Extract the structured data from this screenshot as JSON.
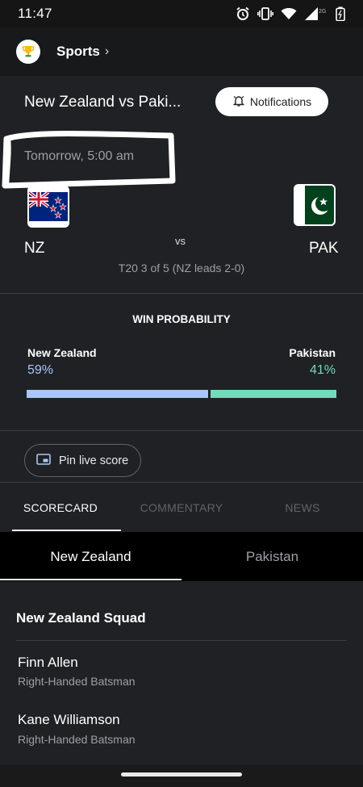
{
  "status_bar": {
    "time": "11:47",
    "icons": [
      "alarm-icon",
      "vibrate-icon",
      "wifi-icon",
      "signal-icon",
      "battery-icon"
    ],
    "network_label": "2G"
  },
  "header": {
    "title": "Sports",
    "chevron": "›",
    "logo_icon": "trophy-icon"
  },
  "match": {
    "title": "New Zealand vs Paki...",
    "notifications_label": "Notifications",
    "time": "Tomorrow, 5:00 am",
    "team1": {
      "abbr": "NZ",
      "flag": "new-zealand-flag"
    },
    "team2": {
      "abbr": "PAK",
      "flag": "pakistan-flag"
    },
    "vs": "vs",
    "series": "T20 3 of 5 (NZ leads 2-0)"
  },
  "win_probability": {
    "title": "WIN PROBABILITY",
    "team1": {
      "name": "New Zealand",
      "pct_label": "59%",
      "value": 0.59,
      "color": "#a8c7fa"
    },
    "team2": {
      "name": "Pakistan",
      "pct_label": "41%",
      "value": 0.41,
      "color": "#6fdcbc"
    }
  },
  "pin_live_score": {
    "label": "Pin live score",
    "icon": "picture-in-picture-icon"
  },
  "tabs": [
    {
      "label": "SCORECARD",
      "active": true
    },
    {
      "label": "COMMENTARY",
      "active": false
    },
    {
      "label": "NEWS",
      "active": false
    }
  ],
  "team_tabs": [
    {
      "label": "New Zealand",
      "active": true
    },
    {
      "label": "Pakistan",
      "active": false
    }
  ],
  "squad": {
    "title": "New Zealand Squad",
    "players": [
      {
        "name": "Finn Allen",
        "role": "Right-Handed Batsman"
      },
      {
        "name": "Kane Williamson",
        "role": "Right-Handed Batsman"
      }
    ]
  }
}
